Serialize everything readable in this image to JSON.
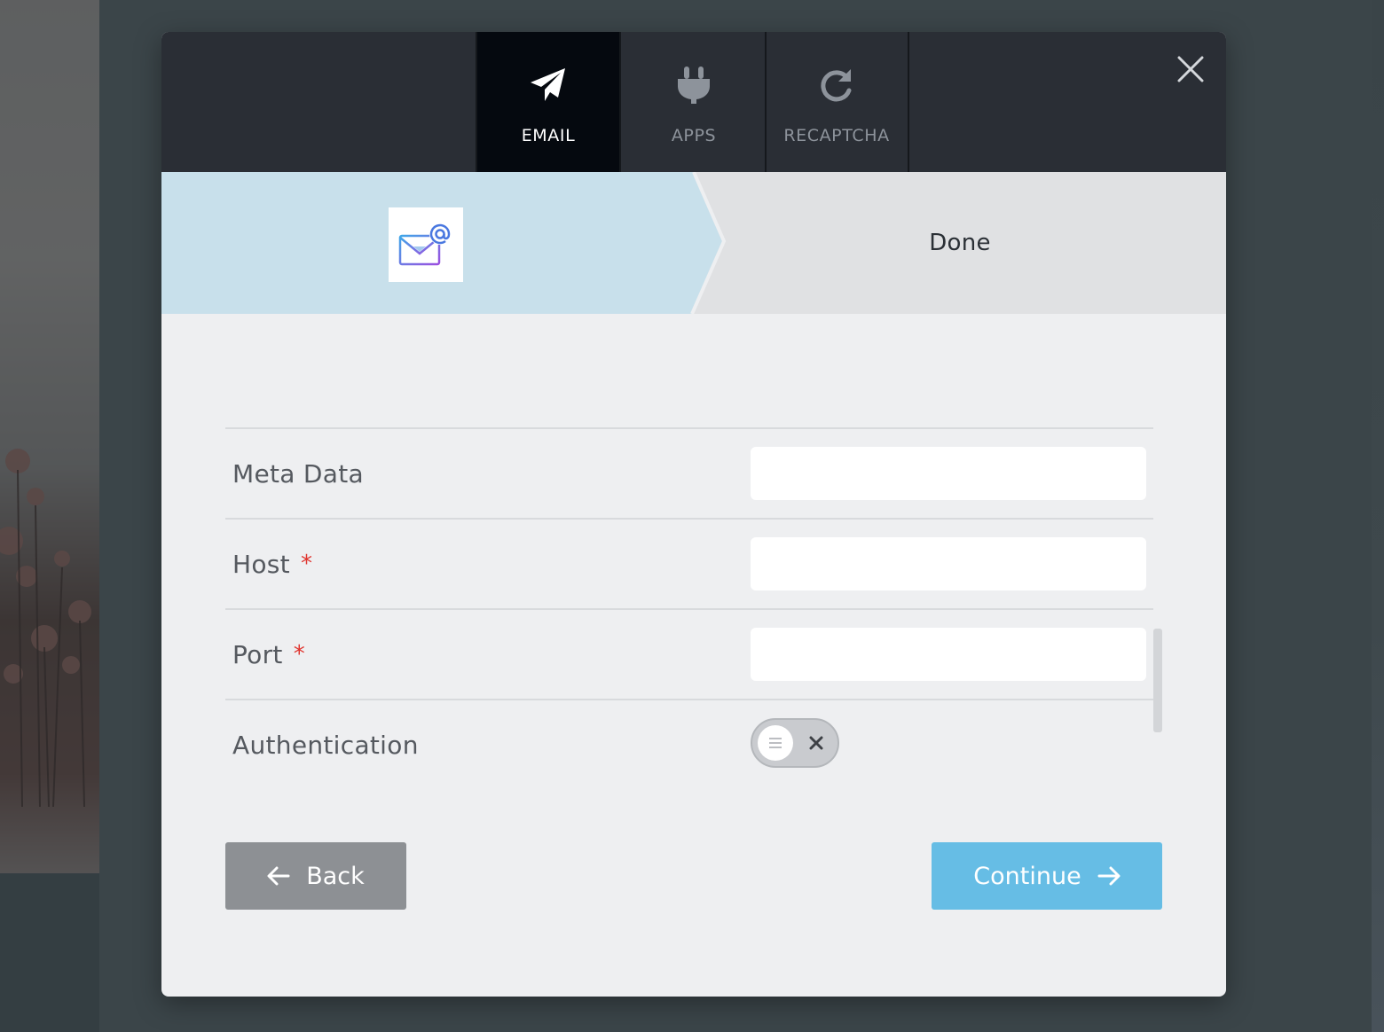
{
  "tabs": [
    {
      "label": "EMAIL",
      "icon": "paper-plane-icon",
      "active": true
    },
    {
      "label": "APPS",
      "icon": "plug-icon",
      "active": false
    },
    {
      "label": "RECAPTCHA",
      "icon": "refresh-icon",
      "active": false
    }
  ],
  "stepper": {
    "step1_logo": "email-at-logo",
    "step2_label": "Done"
  },
  "form": {
    "rows": [
      {
        "label": "Meta Data",
        "required": false,
        "value": ""
      },
      {
        "label": "Host",
        "required": true,
        "value": ""
      },
      {
        "label": "Port",
        "required": true,
        "value": ""
      },
      {
        "label": "Authentication",
        "type": "toggle",
        "enabled": false
      }
    ],
    "required_marker": "*"
  },
  "buttons": {
    "back_label": "Back",
    "continue_label": "Continue"
  },
  "colors": {
    "topbar": "#2a2e35",
    "active_tab": "#05090f",
    "step_active": "#c8e0eb",
    "step_inactive": "#e0e1e3",
    "continue": "#66bde5",
    "back": "#8d9094",
    "required": "#e0352f"
  }
}
